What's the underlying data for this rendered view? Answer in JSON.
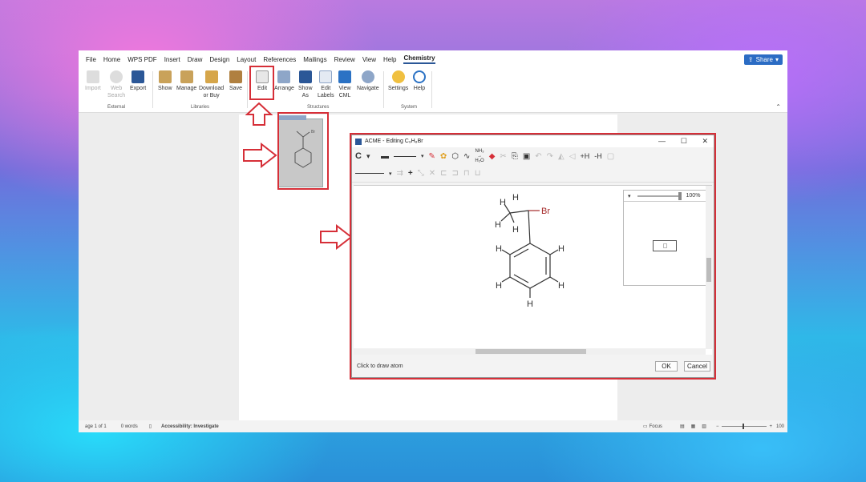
{
  "menu": {
    "items": [
      "File",
      "Home",
      "WPS PDF",
      "Insert",
      "Draw",
      "Design",
      "Layout",
      "References",
      "Mailings",
      "Review",
      "View",
      "Help",
      "Chemistry"
    ],
    "active": "Chemistry",
    "share_label": "Share"
  },
  "ribbon": {
    "external": {
      "label": "External",
      "buttons": [
        {
          "label": "Import"
        },
        {
          "label": "Web\nSearch"
        },
        {
          "label": "Export"
        }
      ]
    },
    "libraries": {
      "label": "Libraries",
      "buttons": [
        {
          "label": "Show"
        },
        {
          "label": "Manage"
        },
        {
          "label": "Download\nor Buy"
        },
        {
          "label": "Save"
        }
      ]
    },
    "structures": {
      "label": "Structures",
      "buttons": [
        {
          "label": "Edit"
        },
        {
          "label": "Arrange"
        },
        {
          "label": "Show\nAs"
        },
        {
          "label": "Edit\nLabels"
        },
        {
          "label": "View\nCML"
        },
        {
          "label": "Navigate"
        }
      ]
    },
    "system": {
      "label": "System",
      "buttons": [
        {
          "label": "Settings"
        },
        {
          "label": "Help"
        }
      ]
    }
  },
  "status": {
    "page": "age 1 of 1",
    "words": "0 words",
    "accessibility": "Accessibility: Investigate",
    "focus": "Focus",
    "zoom": "100"
  },
  "dialog": {
    "title": "ACME - Editing C₉H₈Br",
    "element": "C",
    "zoom": "100%",
    "status_text": "Click to draw atom",
    "ok_label": "OK",
    "cancel_label": "Cancel",
    "reaction_top": "NH₃",
    "reaction_bottom": "H₂O"
  },
  "molecule": {
    "atoms": {
      "h1": "H",
      "h2": "H",
      "h3": "H",
      "h4": "H",
      "br": "Br",
      "ring_h_tl": "H",
      "ring_h_tr": "H",
      "ring_h_bl": "H",
      "ring_h_br": "H",
      "ring_h_b": "H"
    }
  },
  "colors": {
    "accent": "#2b5797",
    "annotation": "#d62f38",
    "bromine": "#a52a2a"
  }
}
